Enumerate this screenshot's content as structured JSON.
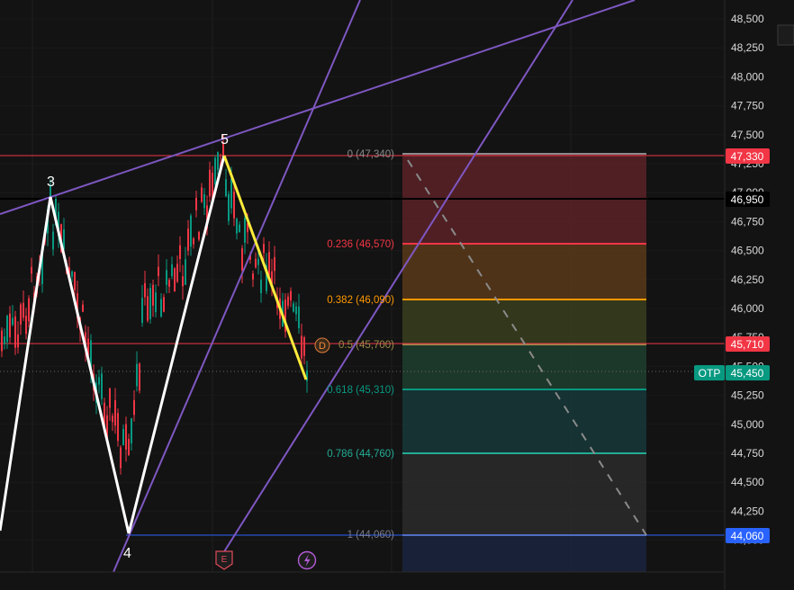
{
  "symbol_code": "OTP",
  "price_axis": {
    "ticks": [
      "48,500",
      "48,250",
      "48,000",
      "47,750",
      "47,500",
      "47,250",
      "47,000",
      "46,750",
      "46,500",
      "46,250",
      "46,000",
      "45,750",
      "45,500",
      "45,250",
      "45,000",
      "44,750",
      "44,500",
      "44,250",
      "44,000"
    ]
  },
  "price_badges": {
    "fib_top": "47,330",
    "black_line": "46,950",
    "red_line": "45,710",
    "last_price": "45,450",
    "fib_bottom": "44,060"
  },
  "fib_levels": [
    {
      "ratio": "0",
      "price": "47,340",
      "label": "0 (47,340)",
      "color": "#8a8a8a"
    },
    {
      "ratio": "0.236",
      "price": "46,570",
      "label": "0.236 (46,570)",
      "color": "#f23645"
    },
    {
      "ratio": "0.382",
      "price": "46,090",
      "label": "0.382 (46,090)",
      "color": "#ff9800"
    },
    {
      "ratio": "0.5",
      "price": "45,700",
      "label": "0.5 (45,700)",
      "color": "#9a8a4a"
    },
    {
      "ratio": "0.618",
      "price": "45,310",
      "label": "0.618 (45,310)",
      "color": "#089981"
    },
    {
      "ratio": "0.786",
      "price": "44,760",
      "label": "0.786 (44,760)",
      "color": "#22ab94"
    },
    {
      "ratio": "1",
      "price": "44,060",
      "label": "1 (44,060)",
      "color": "#7a7a8a"
    }
  ],
  "wave_labels": [
    "3",
    "5",
    "4"
  ],
  "markers": {
    "dividend": "D",
    "earnings": "E",
    "flash_icon": "lightning-icon"
  },
  "colors": {
    "background": "#131313",
    "up_candle": "#089981",
    "down_candle": "#f23645",
    "trendline": "#7e57c2",
    "wave": "#ffffff",
    "correction": "#ffeb3b",
    "badge_red": "#f23645",
    "badge_teal": "#089981",
    "badge_blue": "#2962ff"
  }
}
